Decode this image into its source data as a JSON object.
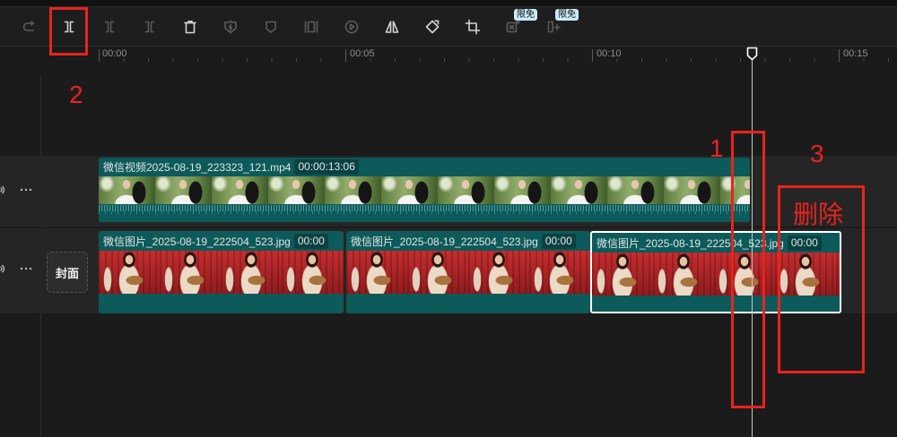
{
  "colors": {
    "background": "#1b1b1b",
    "toolbar": "#1e1e1e",
    "tool_enabled": "#d4d4d4",
    "tool_disabled": "#5c5c5c",
    "badge_bg": "#c9e9f6",
    "track_row": "#252525",
    "clip": "#0d5a5a",
    "clip_pill": "#0a4243",
    "selected_border": "#ffffff",
    "annotation": "#e8231e"
  },
  "toolbar": {
    "tools": [
      {
        "icon": "redo-icon",
        "disabled": true
      },
      {
        "icon": "split-icon",
        "disabled": false
      },
      {
        "icon": "split-keep-left-icon",
        "disabled": true
      },
      {
        "icon": "split-keep-right-icon",
        "disabled": true
      },
      {
        "icon": "delete-icon",
        "disabled": false
      },
      {
        "icon": "freeze-frame-icon",
        "disabled": true
      },
      {
        "icon": "marker-icon",
        "disabled": true
      },
      {
        "icon": "frame-fit-icon",
        "disabled": true
      },
      {
        "icon": "reverse-play-icon",
        "disabled": true
      },
      {
        "icon": "mirror-icon",
        "disabled": false
      },
      {
        "icon": "rotate-icon",
        "disabled": false
      },
      {
        "icon": "crop-icon",
        "disabled": false
      },
      {
        "icon": "ai-remove-icon",
        "disabled": true,
        "badge": "限免"
      },
      {
        "icon": "ai-expand-icon",
        "disabled": true,
        "badge": "限免"
      }
    ]
  },
  "ruler": {
    "labels": [
      "00:00",
      "00:05",
      "00:10",
      "00:15"
    ]
  },
  "track_controls": {
    "row_icons": [
      "speaker-icon",
      "more-icon"
    ],
    "cover_label": "封面"
  },
  "tracks": {
    "video": {
      "clips": [
        {
          "name": "微信视频2025-08-19_223323_121.mp4",
          "duration": "00:00:13:06",
          "selected": false
        }
      ]
    },
    "image": {
      "clips": [
        {
          "name": "微信图片_2025-08-19_222504_523.jpg",
          "duration": "00:00",
          "selected": false
        },
        {
          "name": "微信图片_2025-08-19_222504_523.jpg",
          "duration": "00:00",
          "selected": false
        },
        {
          "name": "微信图片_2025-08-19_222504_523.jpg",
          "duration": "00:00",
          "selected": true
        }
      ]
    }
  },
  "annotations": {
    "step_1": "1",
    "step_2": "2",
    "step_3": "3",
    "delete_label": "删除"
  }
}
